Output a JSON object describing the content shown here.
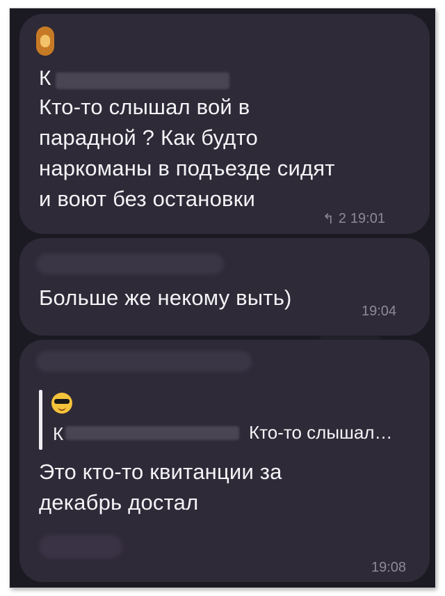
{
  "messages": [
    {
      "sender_initial": "К",
      "text": "Кто-то слышал вой в\nпарадной ? Как будто\nнаркоманы в подъезде сидят\nи воют без остановки",
      "reply_count": "2",
      "time": "19:01"
    },
    {
      "text": "Больше же некому выть)",
      "time": "19:04"
    },
    {
      "quote_initial": "К",
      "quote_text": "Кто-то слышал…",
      "text": "Это кто-то квитанции за\nдекабрь достал",
      "time": "19:08"
    }
  ],
  "icons": {
    "reply": "reply-arrow-icon",
    "avatar": "emoji-avatar-icon",
    "quote_avatar": "cool-sunglasses-emoji-icon"
  }
}
